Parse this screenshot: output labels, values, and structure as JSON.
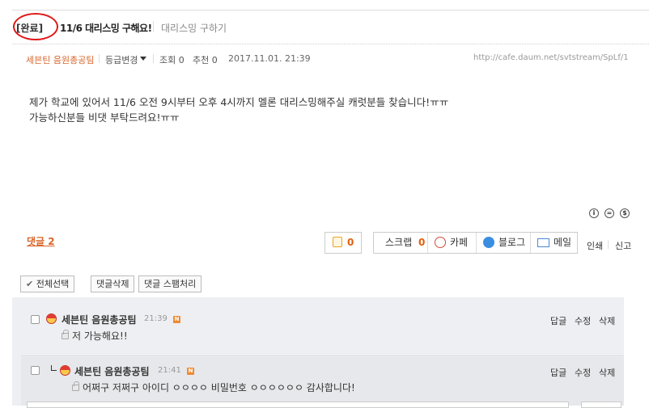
{
  "post": {
    "status_tag": "[완료]",
    "title": "11/6 대리스밍 구해요!",
    "category": "대리스밍 구하기",
    "author": "세븐틴 음원총공팀",
    "grade_change": "등급변경",
    "views_label": "조회 0",
    "recommend_label": "추천 0",
    "date": "2017.11.01. 21:39",
    "url": "http://cafe.daum.net/svtstream/SpLf/1",
    "body_lines": [
      "제가 학교에 있어서 11/6 오전 9시부터 오후 4시까지 멜론 대리스밍해주실 캐럿분들 찾습니다!ㅠㅠ",
      "가능하신분들 비댓 부탁드려요!ㅠㅠ"
    ],
    "license_icons": [
      "cc-by-icon",
      "cc-nd-icon",
      "cc-nc-icon"
    ]
  },
  "actions": {
    "comment_count_label": "댓글 2",
    "like_count": "0",
    "scrap_label": "스크랩",
    "scrap_count": "0",
    "cafe_label": "카페",
    "blog_label": "블로그",
    "mail_label": "메일",
    "print_label": "인쇄",
    "report_label": "신고"
  },
  "comment_toolbar": {
    "select_all": "전체선택",
    "delete": "댓글삭제",
    "spam": "댓글 스팸처리"
  },
  "comments": [
    {
      "author": "세븐틴 음원총공팀",
      "time": "21:39",
      "badge": "N",
      "text": "저 가능해요!!",
      "reply_label": "답글",
      "edit_label": "수정",
      "delete_label": "삭제"
    },
    {
      "author": "세븐틴 음원총공팀",
      "time": "21:41",
      "badge": "N",
      "text": "어쩌구 저쩌구 아이디 ㅇㅇㅇㅇ 비밀번호 ㅇㅇㅇㅇㅇㅇ 감사합니다!",
      "reply_label": "답글",
      "edit_label": "수정",
      "delete_label": "삭제"
    }
  ],
  "colors": {
    "accent_orange": "#d9662a",
    "highlight_circle": "#e01818",
    "comment_bg": "#eeeff2"
  }
}
